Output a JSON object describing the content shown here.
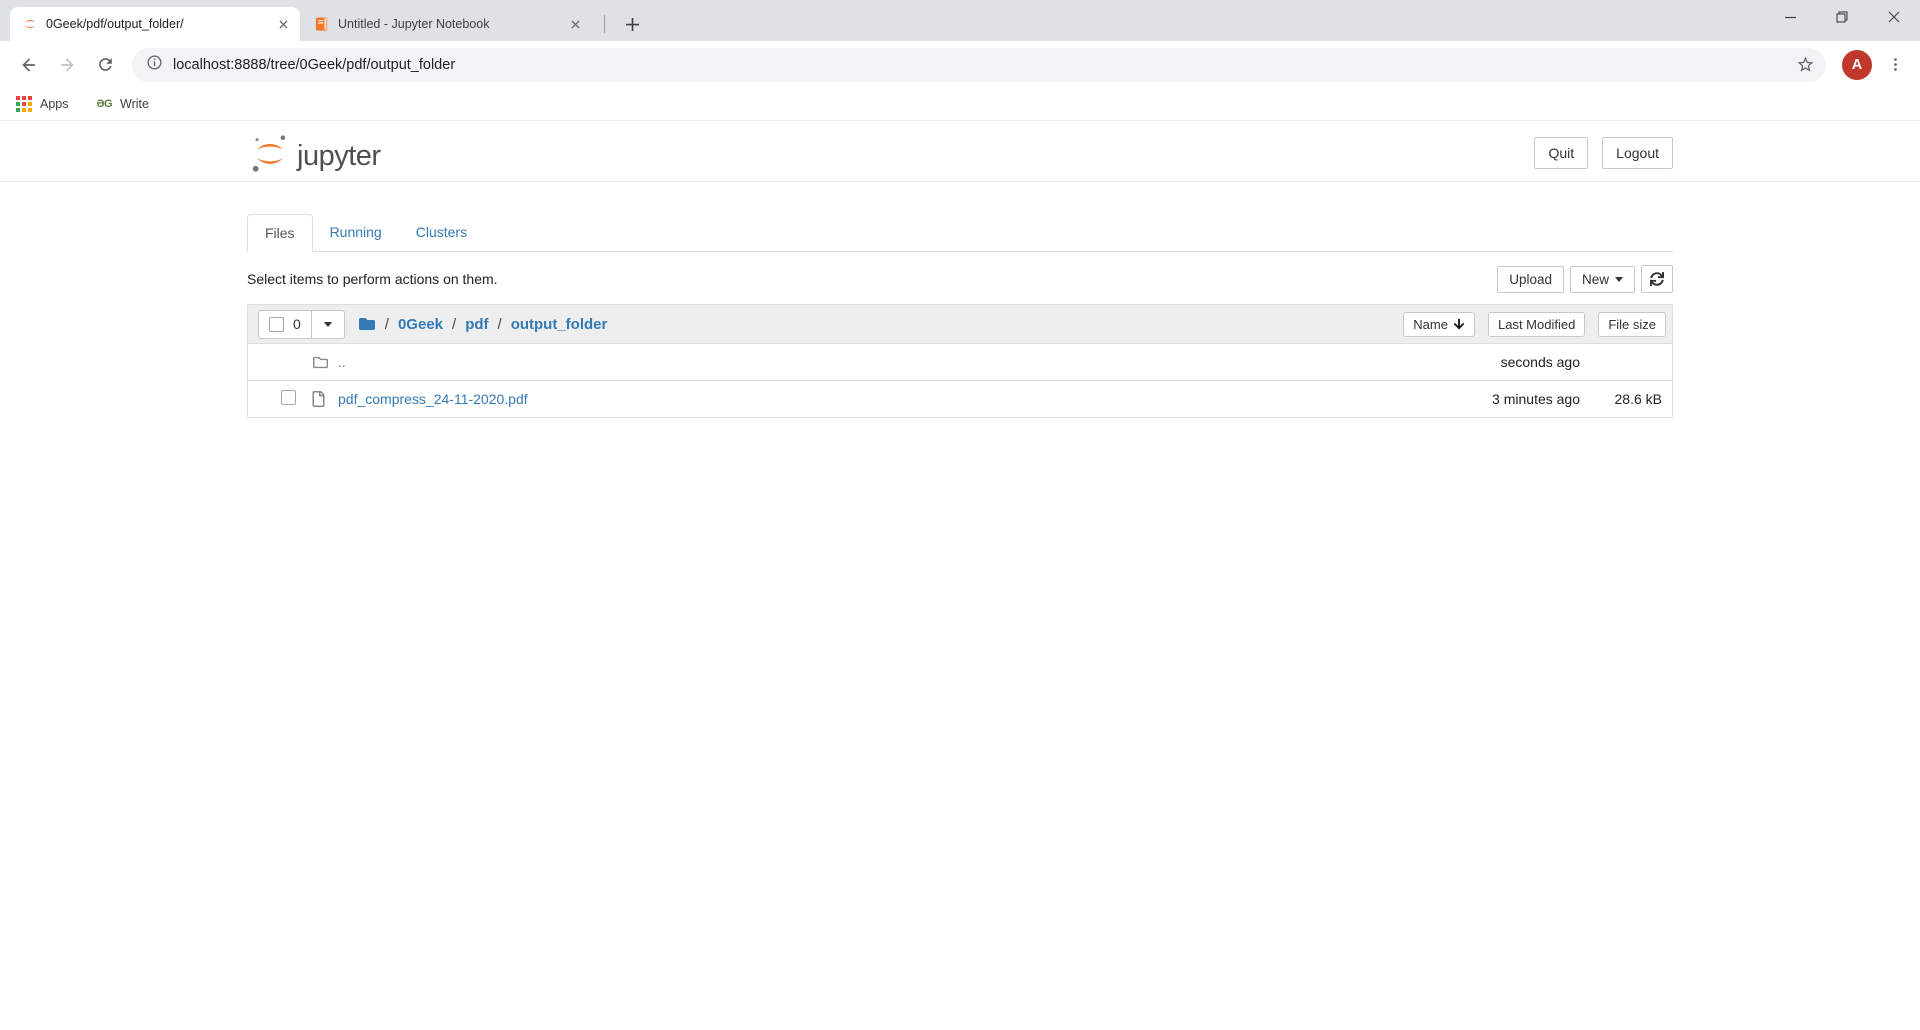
{
  "colors": {
    "accent_orange": "#F37726",
    "link_blue": "#337AB7",
    "avatar_red": "#C0392B",
    "chrome_strip": "#DEE1E6",
    "omnibox_bg": "#F1F3F4",
    "list_header_bg": "#EEEEEE"
  },
  "icons": {
    "jupyter_favicon": "jupyter-rings",
    "notebook_favicon": "orange-book",
    "back": "arrow-left",
    "forward": "arrow-right",
    "reload": "circular-arrow",
    "page_info": "info-circle",
    "bookmark_star": "star-outline",
    "profile_menu": "kebab-dots",
    "apps": "color-grid",
    "minimize": "dash",
    "restore": "overlap-squares",
    "close": "x",
    "new_tab": "plus",
    "folder_solid": "blue-folder",
    "folder_outline": "grey-folder-outline",
    "file_outline": "grey-file-outline",
    "refresh": "sync-arrows",
    "caret_down": "triangle-down",
    "sort_down": "solid-arrow-down"
  },
  "browser": {
    "tabs": [
      {
        "title": "0Geek/pdf/output_folder/"
      },
      {
        "title": "Untitled - Jupyter Notebook"
      }
    ],
    "url": "localhost:8888/tree/0Geek/pdf/output_folder",
    "bookmarks": {
      "apps_label": "Apps",
      "write_label": "Write",
      "write_glyph": "ƏG"
    },
    "avatar_letter": "A"
  },
  "jupyter": {
    "logo_text": "jupyter",
    "quit_label": "Quit",
    "logout_label": "Logout",
    "nav_tabs": [
      {
        "label": "Files"
      },
      {
        "label": "Running"
      },
      {
        "label": "Clusters"
      }
    ],
    "hint": "Select items to perform actions on them.",
    "upload_label": "Upload",
    "new_label": "New",
    "select_count": "0",
    "breadcrumb": {
      "sep": "/",
      "items": [
        {
          "label": "0Geek"
        },
        {
          "label": "pdf"
        },
        {
          "label": "output_folder"
        }
      ]
    },
    "sort": {
      "name_label": "Name",
      "modified_label": "Last Modified",
      "size_label": "File size"
    },
    "rows": [
      {
        "name": "..",
        "modified": "seconds ago",
        "size": ""
      },
      {
        "name": "pdf_compress_24-11-2020.pdf",
        "modified": "3 minutes ago",
        "size": "28.6 kB"
      }
    ]
  }
}
